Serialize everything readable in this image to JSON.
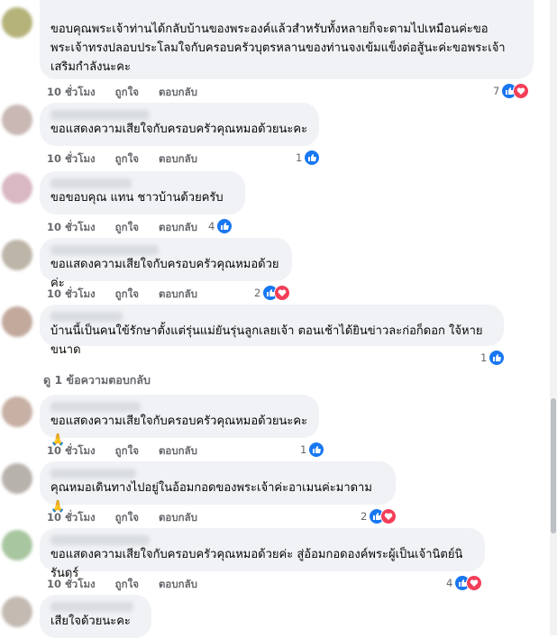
{
  "comments": [
    {
      "text": "ขอบคุณพระเจ้าท่านได้กลับบ้านของพระองค์แล้วสำหรับทั้งหลายก็จะตามไปเหมือนค่ะขอพระเจ้าทรงปลอบประโลมใจกับครอบครัวบุตรหลานของท่านจงเข้มแข็งต่อสู้นะค่ะขอพระเจ้าเสริมกำลังนะคะ",
      "time": "10 ชั่วโมง",
      "like_label": "ถูกใจ",
      "reply_label": "ตอบกลับ",
      "reaction_count": "7",
      "reactions": [
        "like",
        "love"
      ],
      "avatar_color": "#b5b37a"
    },
    {
      "text": "ขอแสดงความเสียใจกับครอบครัวคุณหมอด้วยนะคะ",
      "time": "10 ชั่วโมง",
      "like_label": "ถูกใจ",
      "reply_label": "ตอบกลับ",
      "reaction_count": "1",
      "reactions": [
        "like"
      ],
      "avatar_color": "#c9b8b4"
    },
    {
      "text": "ขอขอบคุณ แทน ชาวบ้านด้วยครับ",
      "time": "10 ชั่วโมง",
      "like_label": "ถูกใจ",
      "reply_label": "ตอบกลับ",
      "reaction_count": "4",
      "reactions": [
        "like"
      ],
      "avatar_color": "#d9b7c3"
    },
    {
      "text": "ขอแสดงความเสียใจกับครอบครัวคุณหมอด้วยค่ะ",
      "time": "10 ชั่วโมง",
      "like_label": "ถูกใจ",
      "reply_label": "ตอบกลับ",
      "reaction_count": "2",
      "reactions": [
        "like",
        "love"
      ],
      "avatar_color": "#bdb5a8"
    },
    {
      "text": "บ้านนี้เป็นคนใข้รักษาตั้งแต่รุ่นแม่ยันรุ่นลูกเลยเจ้า ตอนเช้าได้ยินข่าวละก่อก็ดอก ใจ้หายขนาด",
      "time": "",
      "like_label": "",
      "reply_label": "",
      "reaction_count": "1",
      "reactions": [
        "like"
      ],
      "avatar_color": "#c2a99c"
    },
    {
      "text": "ขอแสดงความเสียใจกับครอบครัวคุณหมอด้วยนะคะ🙏",
      "time": "10 ชั่วโมง",
      "like_label": "ถูกใจ",
      "reply_label": "ตอบกลับ",
      "reaction_count": "1",
      "reactions": [
        "like"
      ],
      "avatar_color": "#c7b0a4"
    },
    {
      "text": "คุณหมอเดินทางไปอยู่ในอ้อมกอดของพระเจ้าค่ะอาเมนค่ะมาดาม 🙏",
      "time": "10 ชั่วโมง",
      "like_label": "ถูกใจ",
      "reply_label": "ตอบกลับ",
      "reaction_count": "2",
      "reactions": [
        "like",
        "love"
      ],
      "avatar_color": "#b8b2ad"
    },
    {
      "text": "ขอแสดงความเสียใจกับครอบครัวคุณหมอด้วยค่ะ สู่อ้อมกอดองค์พระผู้เป็นเจ้านิตย์นิรันดร์",
      "time": "10 ชั่วโมง",
      "like_label": "ถูกใจ",
      "reply_label": "ตอบกลับ",
      "reaction_count": "4",
      "reactions": [
        "like",
        "love"
      ],
      "avatar_color": "#a8c6a0"
    },
    {
      "text": "เสียใจด้วยนะคะ",
      "time": "",
      "like_label": "",
      "reply_label": "",
      "reaction_count": "",
      "reactions": [],
      "avatar_color": "#c4bab2"
    }
  ],
  "view_replies_label": "ดู 1 ข้อความตอบกลับ"
}
